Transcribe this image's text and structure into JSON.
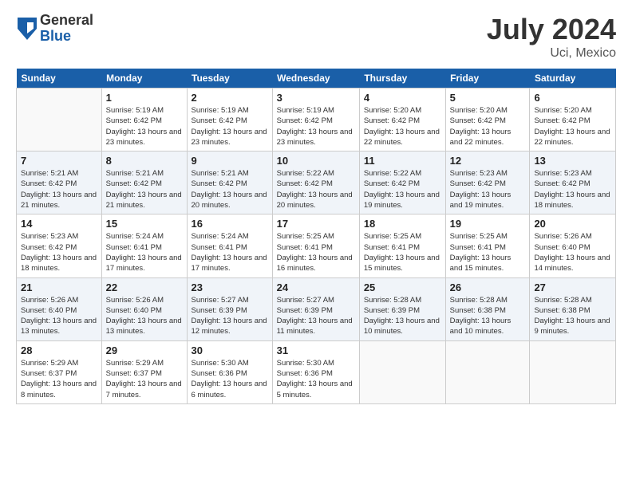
{
  "header": {
    "logo_general": "General",
    "logo_blue": "Blue",
    "title": "July 2024",
    "location": "Uci, Mexico"
  },
  "columns": [
    "Sunday",
    "Monday",
    "Tuesday",
    "Wednesday",
    "Thursday",
    "Friday",
    "Saturday"
  ],
  "weeks": [
    [
      {
        "day": "",
        "sunrise": "",
        "sunset": "",
        "daylight": ""
      },
      {
        "day": "1",
        "sunrise": "Sunrise: 5:19 AM",
        "sunset": "Sunset: 6:42 PM",
        "daylight": "Daylight: 13 hours and 23 minutes."
      },
      {
        "day": "2",
        "sunrise": "Sunrise: 5:19 AM",
        "sunset": "Sunset: 6:42 PM",
        "daylight": "Daylight: 13 hours and 23 minutes."
      },
      {
        "day": "3",
        "sunrise": "Sunrise: 5:19 AM",
        "sunset": "Sunset: 6:42 PM",
        "daylight": "Daylight: 13 hours and 23 minutes."
      },
      {
        "day": "4",
        "sunrise": "Sunrise: 5:20 AM",
        "sunset": "Sunset: 6:42 PM",
        "daylight": "Daylight: 13 hours and 22 minutes."
      },
      {
        "day": "5",
        "sunrise": "Sunrise: 5:20 AM",
        "sunset": "Sunset: 6:42 PM",
        "daylight": "Daylight: 13 hours and 22 minutes."
      },
      {
        "day": "6",
        "sunrise": "Sunrise: 5:20 AM",
        "sunset": "Sunset: 6:42 PM",
        "daylight": "Daylight: 13 hours and 22 minutes."
      }
    ],
    [
      {
        "day": "7",
        "sunrise": "Sunrise: 5:21 AM",
        "sunset": "Sunset: 6:42 PM",
        "daylight": "Daylight: 13 hours and 21 minutes."
      },
      {
        "day": "8",
        "sunrise": "Sunrise: 5:21 AM",
        "sunset": "Sunset: 6:42 PM",
        "daylight": "Daylight: 13 hours and 21 minutes."
      },
      {
        "day": "9",
        "sunrise": "Sunrise: 5:21 AM",
        "sunset": "Sunset: 6:42 PM",
        "daylight": "Daylight: 13 hours and 20 minutes."
      },
      {
        "day": "10",
        "sunrise": "Sunrise: 5:22 AM",
        "sunset": "Sunset: 6:42 PM",
        "daylight": "Daylight: 13 hours and 20 minutes."
      },
      {
        "day": "11",
        "sunrise": "Sunrise: 5:22 AM",
        "sunset": "Sunset: 6:42 PM",
        "daylight": "Daylight: 13 hours and 19 minutes."
      },
      {
        "day": "12",
        "sunrise": "Sunrise: 5:23 AM",
        "sunset": "Sunset: 6:42 PM",
        "daylight": "Daylight: 13 hours and 19 minutes."
      },
      {
        "day": "13",
        "sunrise": "Sunrise: 5:23 AM",
        "sunset": "Sunset: 6:42 PM",
        "daylight": "Daylight: 13 hours and 18 minutes."
      }
    ],
    [
      {
        "day": "14",
        "sunrise": "Sunrise: 5:23 AM",
        "sunset": "Sunset: 6:42 PM",
        "daylight": "Daylight: 13 hours and 18 minutes."
      },
      {
        "day": "15",
        "sunrise": "Sunrise: 5:24 AM",
        "sunset": "Sunset: 6:41 PM",
        "daylight": "Daylight: 13 hours and 17 minutes."
      },
      {
        "day": "16",
        "sunrise": "Sunrise: 5:24 AM",
        "sunset": "Sunset: 6:41 PM",
        "daylight": "Daylight: 13 hours and 17 minutes."
      },
      {
        "day": "17",
        "sunrise": "Sunrise: 5:25 AM",
        "sunset": "Sunset: 6:41 PM",
        "daylight": "Daylight: 13 hours and 16 minutes."
      },
      {
        "day": "18",
        "sunrise": "Sunrise: 5:25 AM",
        "sunset": "Sunset: 6:41 PM",
        "daylight": "Daylight: 13 hours and 15 minutes."
      },
      {
        "day": "19",
        "sunrise": "Sunrise: 5:25 AM",
        "sunset": "Sunset: 6:41 PM",
        "daylight": "Daylight: 13 hours and 15 minutes."
      },
      {
        "day": "20",
        "sunrise": "Sunrise: 5:26 AM",
        "sunset": "Sunset: 6:40 PM",
        "daylight": "Daylight: 13 hours and 14 minutes."
      }
    ],
    [
      {
        "day": "21",
        "sunrise": "Sunrise: 5:26 AM",
        "sunset": "Sunset: 6:40 PM",
        "daylight": "Daylight: 13 hours and 13 minutes."
      },
      {
        "day": "22",
        "sunrise": "Sunrise: 5:26 AM",
        "sunset": "Sunset: 6:40 PM",
        "daylight": "Daylight: 13 hours and 13 minutes."
      },
      {
        "day": "23",
        "sunrise": "Sunrise: 5:27 AM",
        "sunset": "Sunset: 6:39 PM",
        "daylight": "Daylight: 13 hours and 12 minutes."
      },
      {
        "day": "24",
        "sunrise": "Sunrise: 5:27 AM",
        "sunset": "Sunset: 6:39 PM",
        "daylight": "Daylight: 13 hours and 11 minutes."
      },
      {
        "day": "25",
        "sunrise": "Sunrise: 5:28 AM",
        "sunset": "Sunset: 6:39 PM",
        "daylight": "Daylight: 13 hours and 10 minutes."
      },
      {
        "day": "26",
        "sunrise": "Sunrise: 5:28 AM",
        "sunset": "Sunset: 6:38 PM",
        "daylight": "Daylight: 13 hours and 10 minutes."
      },
      {
        "day": "27",
        "sunrise": "Sunrise: 5:28 AM",
        "sunset": "Sunset: 6:38 PM",
        "daylight": "Daylight: 13 hours and 9 minutes."
      }
    ],
    [
      {
        "day": "28",
        "sunrise": "Sunrise: 5:29 AM",
        "sunset": "Sunset: 6:37 PM",
        "daylight": "Daylight: 13 hours and 8 minutes."
      },
      {
        "day": "29",
        "sunrise": "Sunrise: 5:29 AM",
        "sunset": "Sunset: 6:37 PM",
        "daylight": "Daylight: 13 hours and 7 minutes."
      },
      {
        "day": "30",
        "sunrise": "Sunrise: 5:30 AM",
        "sunset": "Sunset: 6:36 PM",
        "daylight": "Daylight: 13 hours and 6 minutes."
      },
      {
        "day": "31",
        "sunrise": "Sunrise: 5:30 AM",
        "sunset": "Sunset: 6:36 PM",
        "daylight": "Daylight: 13 hours and 5 minutes."
      },
      {
        "day": "",
        "sunrise": "",
        "sunset": "",
        "daylight": ""
      },
      {
        "day": "",
        "sunrise": "",
        "sunset": "",
        "daylight": ""
      },
      {
        "day": "",
        "sunrise": "",
        "sunset": "",
        "daylight": ""
      }
    ]
  ]
}
